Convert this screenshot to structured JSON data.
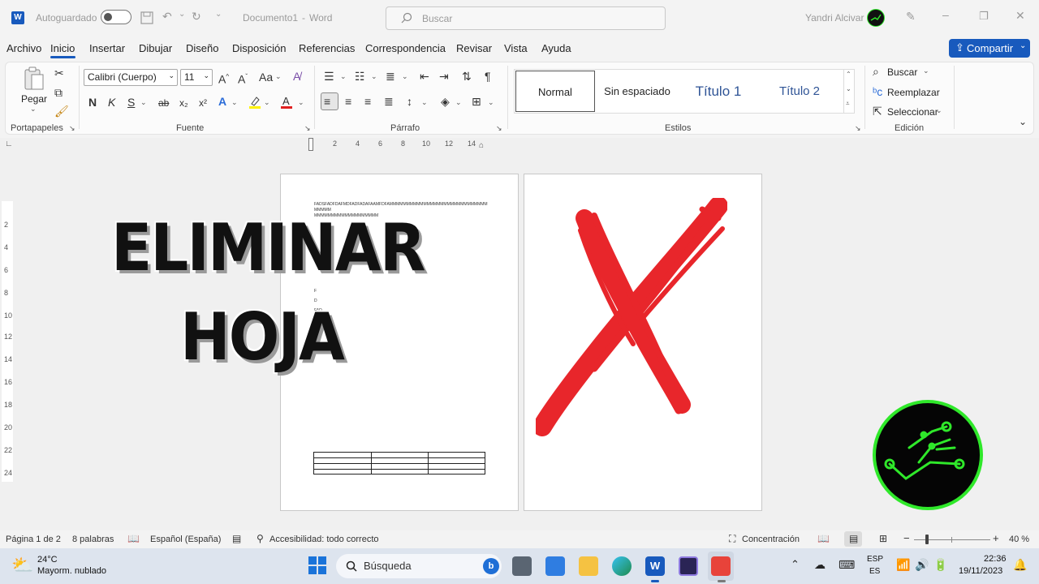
{
  "titlebar": {
    "autosave_label": "Autoguardado",
    "doc_title": "Documento1",
    "app_name": "Word",
    "separator": "-",
    "search_placeholder": "Buscar",
    "user_name": "Yandri Alcivar"
  },
  "menu": {
    "items": [
      "Archivo",
      "Inicio",
      "Insertar",
      "Dibujar",
      "Diseño",
      "Disposición",
      "Referencias",
      "Correspondencia",
      "Revisar",
      "Vista",
      "Ayuda"
    ],
    "active": "Inicio",
    "share_label": "Compartir"
  },
  "ribbon": {
    "clipboard": {
      "paste_label": "Pegar",
      "group_label": "Portapapeles"
    },
    "font": {
      "font_name": "Calibri (Cuerpo)",
      "font_size": "11",
      "grow": "A^",
      "shrink": "Aˇ",
      "case": "Aa",
      "bold": "N",
      "italic": "K",
      "underline": "S",
      "strike": "ab",
      "subscript": "x₂",
      "superscript": "x²",
      "group_label": "Fuente"
    },
    "paragraph": {
      "group_label": "Párrafo"
    },
    "styles": {
      "items": [
        "Normal",
        "Sin espaciado",
        "Título 1",
        "Título 2"
      ],
      "group_label": "Estilos"
    },
    "editing": {
      "find": "Buscar",
      "replace": "Reemplazar",
      "select": "Seleccionar",
      "group_label": "Edición"
    }
  },
  "ruler": {
    "horizontal": [
      "2",
      "4",
      "6",
      "8",
      "10",
      "12",
      "14"
    ],
    "vertical": [
      "2",
      "4",
      "6",
      "8",
      "10",
      "12",
      "14",
      "16",
      "18",
      "20",
      "22",
      "24"
    ]
  },
  "document": {
    "page1_line1": "FADSFADFDAFMDFADFADAFAAMFDFAMMMMMMMMMMMMMMMMMMMMMMMMMMMMMMMMMM",
    "page1_line2": "MMMMMMMMMMMMMMMMMMM",
    "page1_small": [
      "D",
      "F",
      "D",
      "FAD"
    ]
  },
  "overlay": {
    "title_line1": "ELIMINAR",
    "title_line2": "HOJA"
  },
  "status": {
    "page": "Página 1 de 2",
    "words": "8 palabras",
    "language": "Español (España)",
    "accessibility": "Accesibilidad: todo correcto",
    "focus": "Concentración",
    "zoom": "40 %"
  },
  "taskbar": {
    "weather_temp": "24°C",
    "weather_desc": "Mayorm. nublado",
    "search_placeholder": "Búsqueda",
    "lang_line1": "ESP",
    "lang_line2": "ES",
    "time": "22:36",
    "date": "19/11/2023"
  },
  "colors": {
    "accent": "#185abd",
    "x_mark": "#e8262b",
    "logo_ring": "#2fe82a"
  }
}
